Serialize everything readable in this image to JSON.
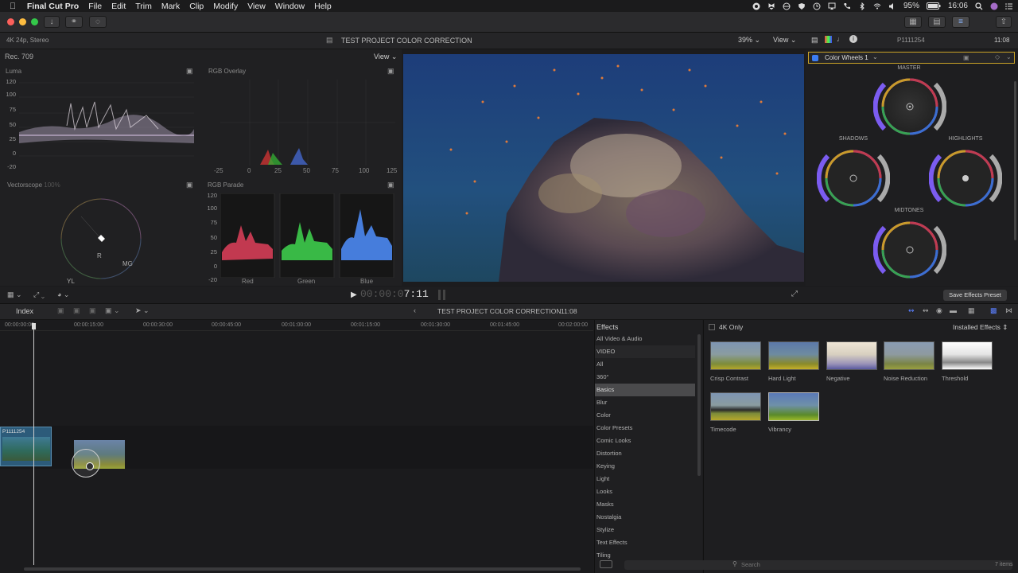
{
  "menubar": {
    "app": "Final Cut Pro",
    "items": [
      "File",
      "Edit",
      "Trim",
      "Mark",
      "Clip",
      "Modify",
      "View",
      "Window",
      "Help"
    ],
    "battery": "95%",
    "time": "16:06"
  },
  "header": {
    "format": "4K 24p, Stereo",
    "project_title": "TEST PROJECT COLOR CORRECTION",
    "zoom": "39%",
    "view_label": "View",
    "clip_name": "P1111254",
    "duration_right": "11:08"
  },
  "scopes": {
    "colorspace": "Rec. 709",
    "view_label": "View",
    "luma": {
      "title": "Luma",
      "scale": [
        "120",
        "100",
        "75",
        "50",
        "25",
        "0",
        "-20"
      ]
    },
    "rgb_overlay": {
      "title": "RGB Overlay",
      "x_scale": [
        "-25",
        "0",
        "25",
        "50",
        "75",
        "100",
        "125"
      ]
    },
    "vectorscope": {
      "title": "Vectorscope",
      "zoom": "100%",
      "targets": [
        "R",
        "MG",
        "YL",
        "B",
        "G",
        "CY"
      ]
    },
    "rgb_parade": {
      "title": "RGB Parade",
      "scale": [
        "120",
        "100",
        "75",
        "50",
        "25",
        "0",
        "-20"
      ],
      "channels": [
        "Red",
        "Green",
        "Blue"
      ]
    }
  },
  "inspector": {
    "effect_name": "Color Wheels 1",
    "wheels": [
      "MASTER",
      "SHADOWS",
      "HIGHLIGHTS",
      "MIDTONES"
    ],
    "save_preset": "Save Effects Preset"
  },
  "playback": {
    "timecode_dim": "00:00:0",
    "timecode": "7:11"
  },
  "timeline": {
    "index_label": "Index",
    "title": "TEST PROJECT COLOR CORRECTION",
    "duration": "11:08",
    "ruler": [
      "00:00:00:00",
      "00:00:15:00",
      "00:00:30:00",
      "00:00:45:00",
      "00:01:00:00",
      "00:01:15:00",
      "00:01:30:00",
      "00:01:45:00",
      "00:02:00:00"
    ],
    "clip_name": "P1111254"
  },
  "effects": {
    "title": "Effects",
    "categories": [
      {
        "label": "All Video & Audio",
        "type": "item"
      },
      {
        "label": "VIDEO",
        "type": "section"
      },
      {
        "label": "All",
        "type": "item"
      },
      {
        "label": "360°",
        "type": "item"
      },
      {
        "label": "Basics",
        "type": "selected"
      },
      {
        "label": "Blur",
        "type": "item"
      },
      {
        "label": "Color",
        "type": "item"
      },
      {
        "label": "Color Presets",
        "type": "item"
      },
      {
        "label": "Comic Looks",
        "type": "item"
      },
      {
        "label": "Distortion",
        "type": "item"
      },
      {
        "label": "Keying",
        "type": "item"
      },
      {
        "label": "Light",
        "type": "item"
      },
      {
        "label": "Looks",
        "type": "item"
      },
      {
        "label": "Masks",
        "type": "item"
      },
      {
        "label": "Nostalgia",
        "type": "item"
      },
      {
        "label": "Stylize",
        "type": "item"
      },
      {
        "label": "Text Effects",
        "type": "item"
      },
      {
        "label": "Tiling",
        "type": "item"
      }
    ],
    "filter": "4K Only",
    "installed": "Installed Effects",
    "thumbnails": [
      "Crisp Contrast",
      "Hard Light",
      "Negative",
      "Noise Reduction",
      "Threshold",
      "Timecode",
      "Vibrancy"
    ],
    "search_placeholder": "Search",
    "count": "7 items"
  }
}
